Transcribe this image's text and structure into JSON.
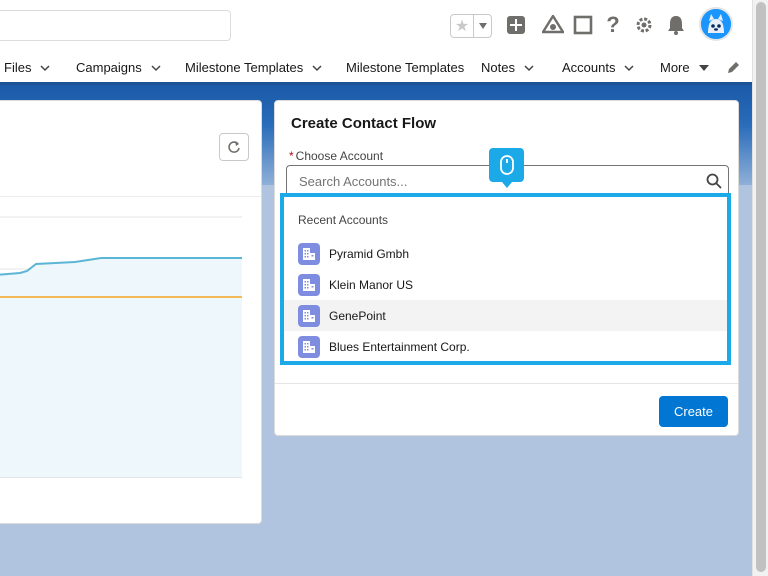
{
  "header": {
    "search_placeholder": "",
    "icons": [
      "star-icon",
      "chevron-down-icon",
      "add-icon",
      "trailhead-icon",
      "square-icon",
      "help-icon",
      "gear-icon",
      "bell-icon",
      "avatar"
    ]
  },
  "nav": {
    "items": [
      {
        "label": "Files",
        "has_menu": true
      },
      {
        "label": "Campaigns",
        "has_menu": true
      },
      {
        "label": "Milestone Templates",
        "has_menu": true
      },
      {
        "label": "Milestone Templates",
        "has_menu": false
      },
      {
        "label": "Notes",
        "has_menu": true
      },
      {
        "label": "Accounts",
        "has_menu": true
      },
      {
        "label": "More",
        "has_menu": true
      }
    ]
  },
  "left_card": {
    "refresh_icon": "refresh-icon"
  },
  "form": {
    "title": "Create Contact Flow",
    "required_mark": "*",
    "field_label": "Choose Account",
    "input_placeholder": "Search Accounts...",
    "input_value": "",
    "create_label": "Create"
  },
  "dropdown": {
    "header": "Recent Accounts",
    "items": [
      "Pyramid Gmbh",
      "Klein Manor US",
      "GenePoint",
      "Blues Entertainment Corp."
    ],
    "highlighted_index": 2
  },
  "colors": {
    "brand_blue": "#0176d3",
    "highlight_cyan": "#1ba9e8",
    "account_icon": "#7f8de1",
    "chart_line_blue": "#5bb5d5",
    "chart_line_orange": "#f5a623"
  }
}
